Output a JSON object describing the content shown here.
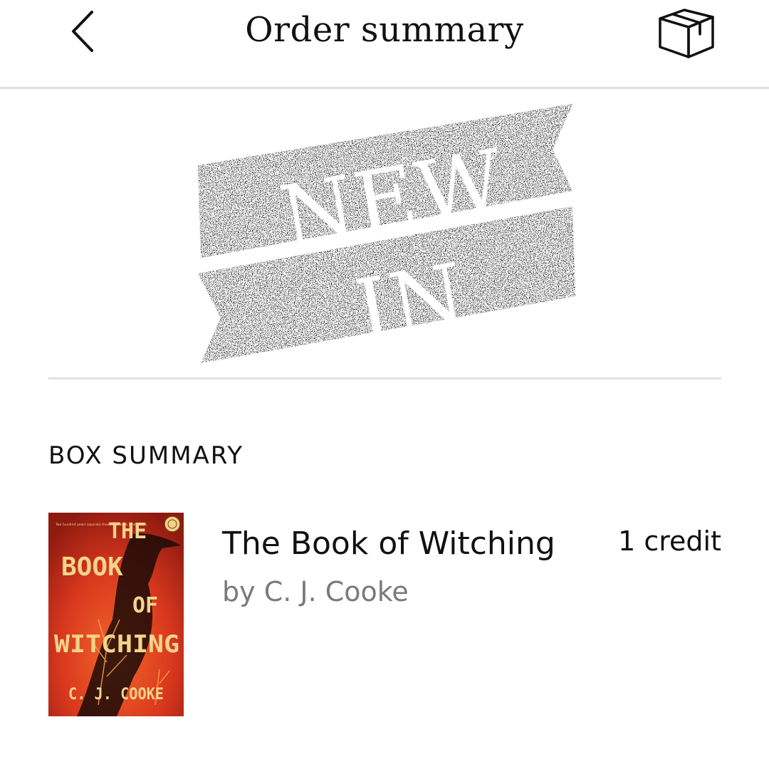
{
  "header": {
    "back_icon": "chevron-left-icon",
    "title": "Order summary",
    "box_icon": "box-icon"
  },
  "banner": {
    "line1": "NEW",
    "line2": "IN",
    "ribbon_color": "#111111",
    "text_color": "#ffffff"
  },
  "box_summary": {
    "heading": "BOX SUMMARY",
    "items": [
      {
        "title": "The Book of Witching",
        "author": "by C. J. Cooke",
        "credit": "1 credit",
        "cover": {
          "tagline": "Two hundred years separate them. One book binds them.",
          "title_words": [
            "THE",
            "BOOK",
            "OF",
            "WITCHING"
          ],
          "author": "C. J. COOKE",
          "background_color": "#d9381e",
          "text_color": "#f3d48a"
        }
      }
    ]
  }
}
